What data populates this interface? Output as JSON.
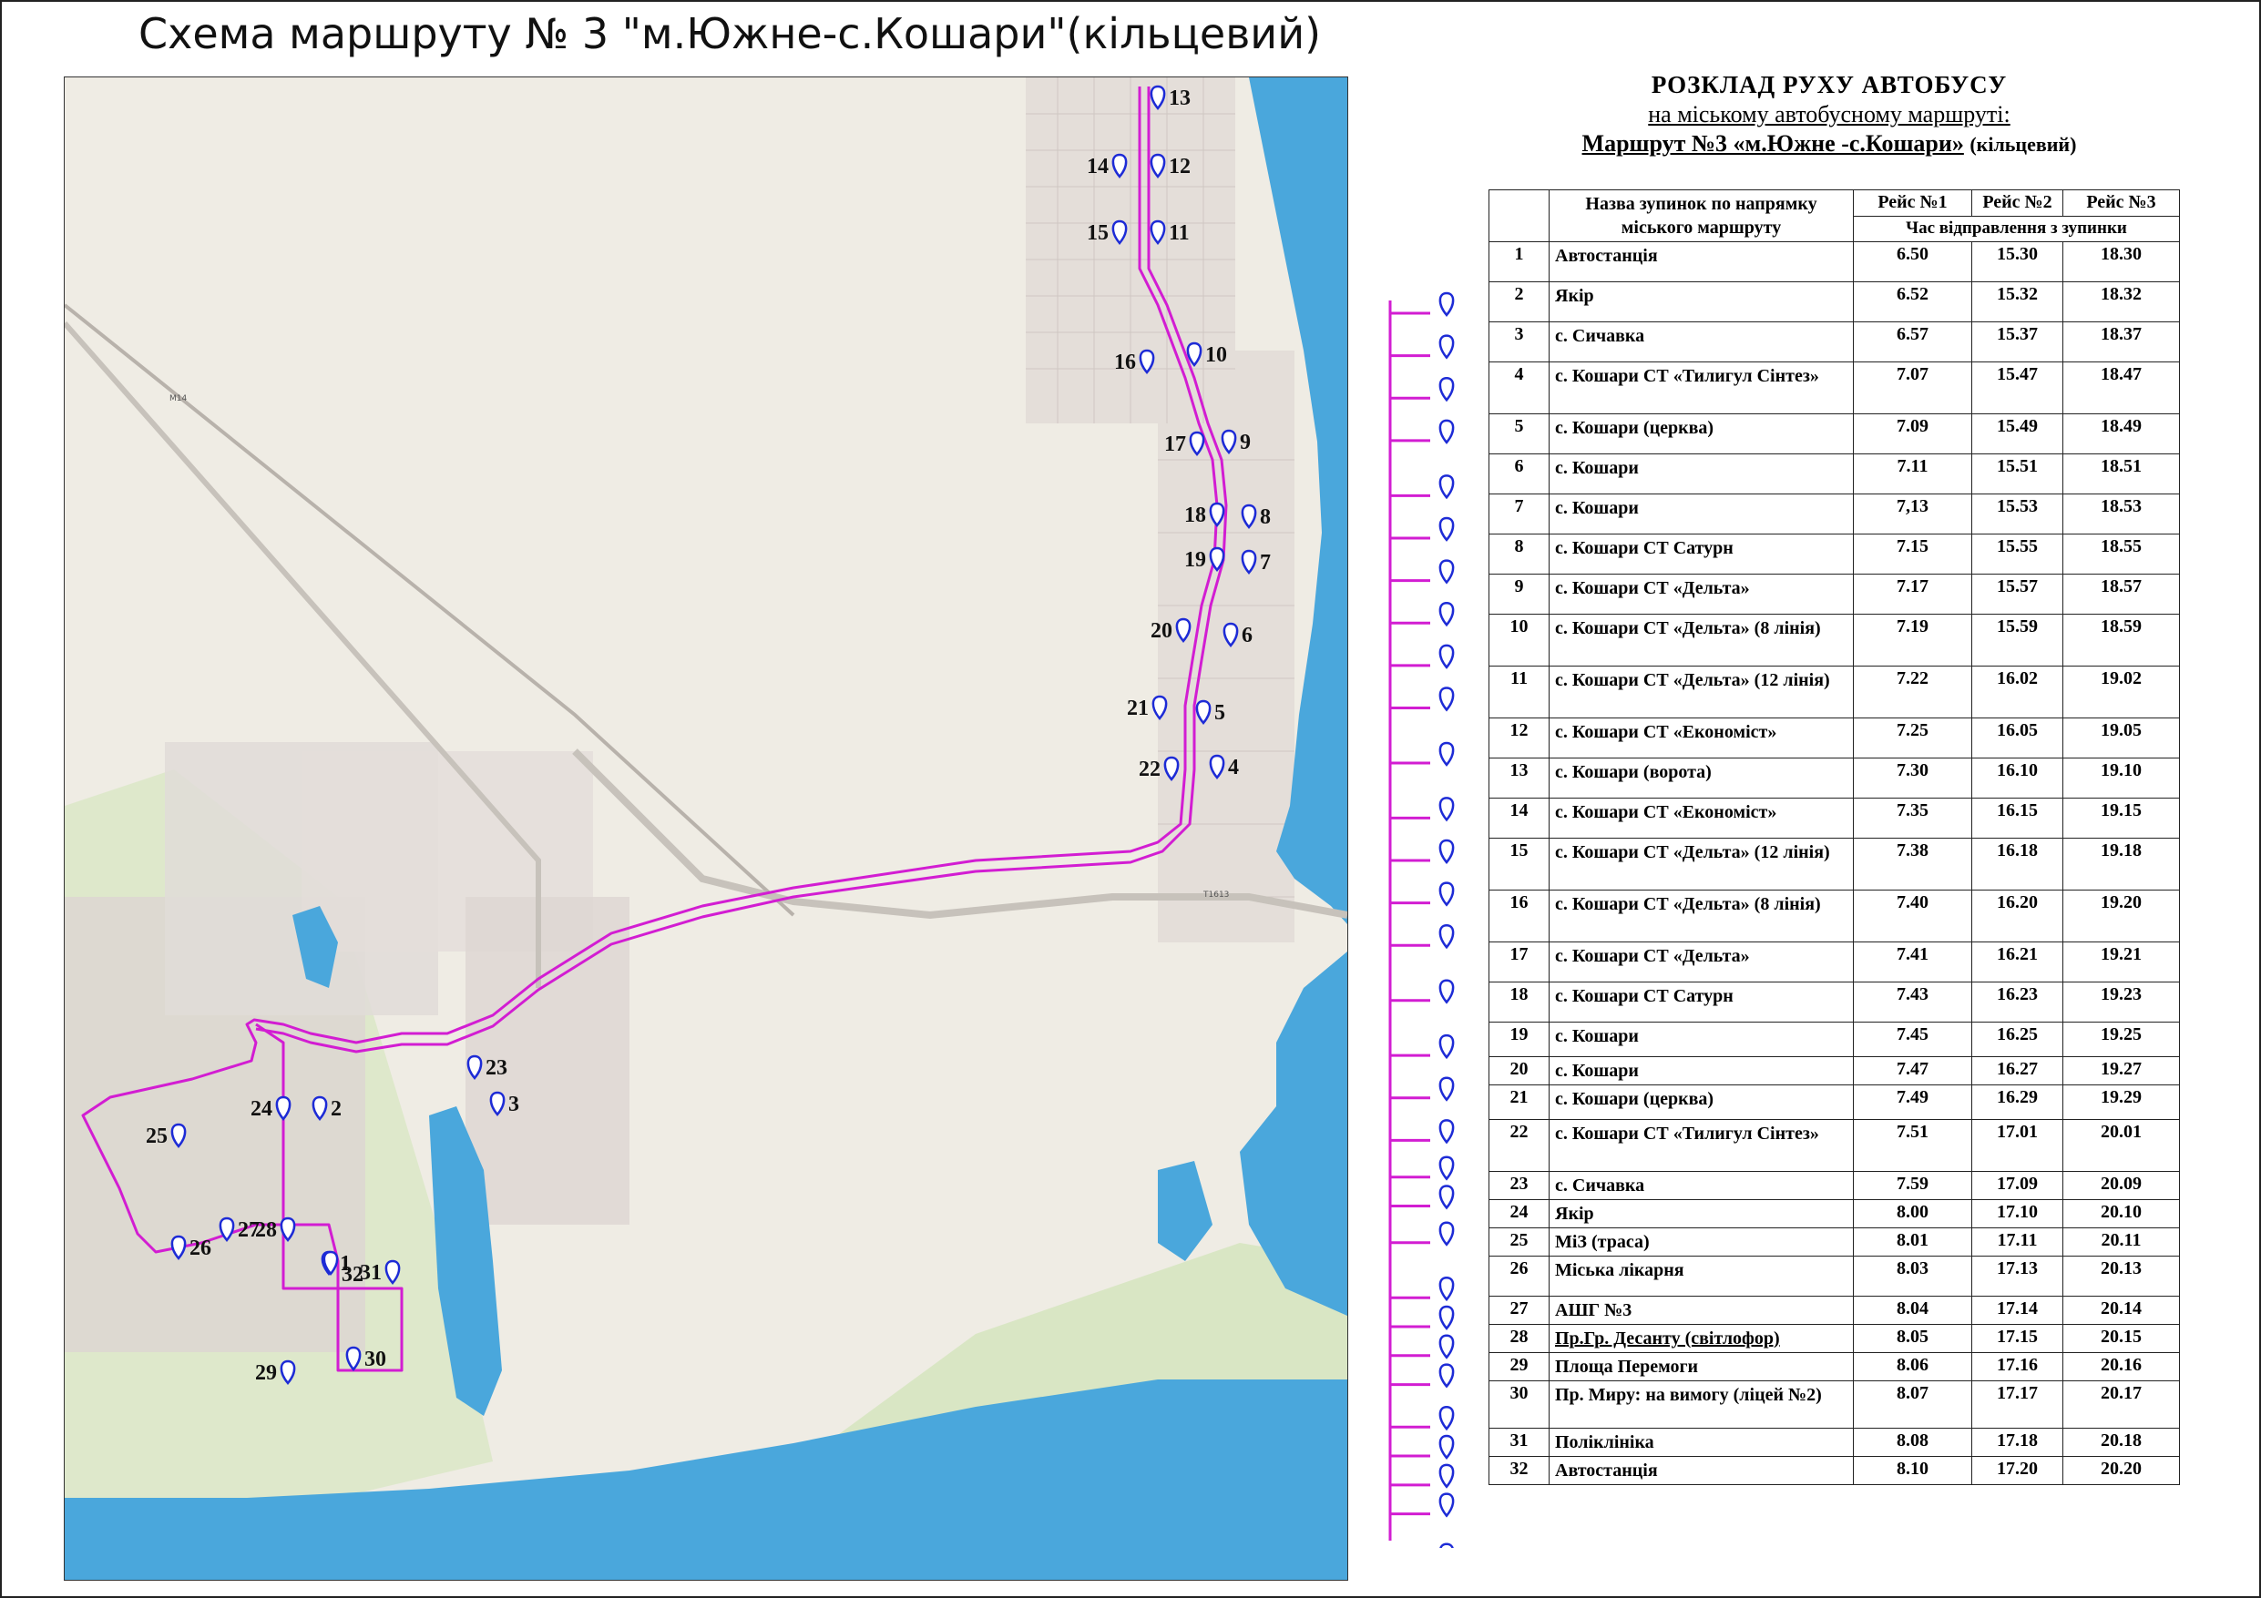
{
  "title": "Схема  маршруту № 3 \"м.Южне-с.Кошари\"(кільцевий)",
  "map": {
    "stops": [
      {
        "num": "1"
      },
      {
        "num": "2"
      },
      {
        "num": "3"
      },
      {
        "num": "4"
      },
      {
        "num": "5"
      },
      {
        "num": "6"
      },
      {
        "num": "7"
      },
      {
        "num": "8"
      },
      {
        "num": "9"
      },
      {
        "num": "10"
      },
      {
        "num": "11"
      },
      {
        "num": "12"
      },
      {
        "num": "13"
      },
      {
        "num": "14"
      },
      {
        "num": "15"
      },
      {
        "num": "16"
      },
      {
        "num": "17"
      },
      {
        "num": "18"
      },
      {
        "num": "19"
      },
      {
        "num": "20"
      },
      {
        "num": "21"
      },
      {
        "num": "22"
      },
      {
        "num": "23"
      },
      {
        "num": "24"
      },
      {
        "num": "25"
      },
      {
        "num": "26"
      },
      {
        "num": "27"
      },
      {
        "num": "28"
      },
      {
        "num": "29"
      },
      {
        "num": "30"
      },
      {
        "num": "31"
      },
      {
        "num": "32"
      }
    ],
    "route_color": "#d21dd2",
    "marker_color": "#1d2bd6",
    "water_color": "#4aa7dc"
  },
  "schedule": {
    "title": "РОЗКЛАД РУХУ АВТОБУСУ",
    "subtitle": "на міському автобусному маршруті:",
    "route_line_main": "Маршрут №3 «м.Южне -с.Кошари»",
    "route_line_suffix": "(кільцевий)",
    "header": {
      "stop_col": "Назва зупинок по напрямку міського маршруту",
      "trip1": "Рейс №1",
      "trip2": "Рейс №2",
      "trip3": "Рейс №3",
      "departure": "Час відправлення з зупинки"
    },
    "rows": [
      {
        "n": "1",
        "stop": "Автостанція",
        "t1": "6.50",
        "t2": "15.30",
        "t3": "18.30"
      },
      {
        "n": "2",
        "stop": "Якір",
        "t1": "6.52",
        "t2": "15.32",
        "t3": "18.32"
      },
      {
        "n": "3",
        "stop": "с. Сичавка",
        "t1": "6.57",
        "t2": "15.37",
        "t3": "18.37"
      },
      {
        "n": "4",
        "stop": "с. Кошари СТ «Тилигул Сінтез»",
        "t1": "7.07",
        "t2": "15.47",
        "t3": "18.47"
      },
      {
        "n": "5",
        "stop": "с. Кошари (церква)",
        "t1": "7.09",
        "t2": "15.49",
        "t3": "18.49"
      },
      {
        "n": "6",
        "stop": "с. Кошари",
        "t1": "7.11",
        "t2": "15.51",
        "t3": "18.51"
      },
      {
        "n": "7",
        "stop": "с. Кошари",
        "t1": "7,13",
        "t2": "15.53",
        "t3": "18.53"
      },
      {
        "n": "8",
        "stop": "с. Кошари СТ Сатурн",
        "t1": "7.15",
        "t2": "15.55",
        "t3": "18.55"
      },
      {
        "n": "9",
        "stop": "с. Кошари СТ «Дельта»",
        "t1": "7.17",
        "t2": "15.57",
        "t3": "18.57"
      },
      {
        "n": "10",
        "stop": "с. Кошари СТ «Дельта» (8 лінія)",
        "t1": "7.19",
        "t2": "15.59",
        "t3": "18.59"
      },
      {
        "n": "11",
        "stop": "с. Кошари СТ «Дельта» (12 лінія)",
        "t1": "7.22",
        "t2": "16.02",
        "t3": "19.02"
      },
      {
        "n": "12",
        "stop": "с. Кошари СТ «Економіст»",
        "t1": "7.25",
        "t2": "16.05",
        "t3": "19.05"
      },
      {
        "n": "13",
        "stop": "с. Кошари (ворота)",
        "t1": "7.30",
        "t2": "16.10",
        "t3": "19.10"
      },
      {
        "n": "14",
        "stop": "с. Кошари СТ «Економіст»",
        "t1": "7.35",
        "t2": "16.15",
        "t3": "19.15"
      },
      {
        "n": "15",
        "stop": "с. Кошари СТ «Дельта» (12 лінія)",
        "t1": "7.38",
        "t2": "16.18",
        "t3": "19.18"
      },
      {
        "n": "16",
        "stop": "с. Кошари СТ «Дельта» (8 лінія)",
        "t1": "7.40",
        "t2": "16.20",
        "t3": "19.20"
      },
      {
        "n": "17",
        "stop": "с. Кошари СТ «Дельта»",
        "t1": "7.41",
        "t2": "16.21",
        "t3": "19.21"
      },
      {
        "n": "18",
        "stop": "с. Кошари СТ Сатурн",
        "t1": "7.43",
        "t2": "16.23",
        "t3": "19.23"
      },
      {
        "n": "19",
        "stop": "с. Кошари",
        "t1": "7.45",
        "t2": "16.25",
        "t3": "19.25"
      },
      {
        "n": "20",
        "stop": "с. Кошари",
        "t1": "7.47",
        "t2": "16.27",
        "t3": "19.27"
      },
      {
        "n": "21",
        "stop": "с. Кошари (церква)",
        "t1": "7.49",
        "t2": "16.29",
        "t3": "19.29"
      },
      {
        "n": "22",
        "stop": "с. Кошари СТ «Тилигул Сінтез»",
        "t1": "7.51",
        "t2": "17.01",
        "t3": "20.01"
      },
      {
        "n": "23",
        "stop": "с. Сичавка",
        "t1": "7.59",
        "t2": "17.09",
        "t3": "20.09"
      },
      {
        "n": "24",
        "stop": "Якір",
        "t1": "8.00",
        "t2": "17.10",
        "t3": "20.10"
      },
      {
        "n": "25",
        "stop": "МіЗ (траса)",
        "t1": "8.01",
        "t2": "17.11",
        "t3": "20.11"
      },
      {
        "n": "26",
        "stop": "Міська лікарня",
        "t1": "8.03",
        "t2": "17.13",
        "t3": "20.13"
      },
      {
        "n": "27",
        "stop": "АШГ №3",
        "t1": "8.04",
        "t2": "17.14",
        "t3": "20.14"
      },
      {
        "n": "28",
        "stop": "Пр.Гр. Десанту (світлофор)",
        "t1": "8.05",
        "t2": "17.15",
        "t3": "20.15"
      },
      {
        "n": "29",
        "stop": "Площа Перемоги",
        "t1": "8.06",
        "t2": "17.16",
        "t3": "20.16"
      },
      {
        "n": "30",
        "stop": "Пр. Миру: на вимогу (ліцей №2)",
        "t1": "8.07",
        "t2": "17.17",
        "t3": "20.17"
      },
      {
        "n": "31",
        "stop": "Поліклініка",
        "t1": "8.08",
        "t2": "17.18",
        "t3": "20.18"
      },
      {
        "n": "32",
        "stop": "Автостанція",
        "t1": "8.10",
        "t2": "17.20",
        "t3": "20.20"
      }
    ]
  }
}
